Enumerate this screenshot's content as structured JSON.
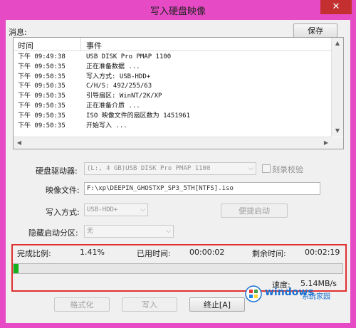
{
  "window": {
    "title": "写入硬盘映像",
    "close_glyph": "✕"
  },
  "messages": {
    "label": "消息:",
    "save_button": "保存",
    "columns": {
      "time": "时间",
      "event": "事件"
    },
    "rows": [
      {
        "time": "下午 09:49:38",
        "event": "USB      DISK Pro PMAP    1100"
      },
      {
        "time": "下午 09:50:35",
        "event": "正在准备数据 ..."
      },
      {
        "time": "下午 09:50:35",
        "event": "写入方式: USB-HDD+"
      },
      {
        "time": "下午 09:50:35",
        "event": "C/H/S: 492/255/63"
      },
      {
        "time": "下午 09:50:35",
        "event": "引导扇区: WinNT/2K/XP"
      },
      {
        "time": "下午 09:50:35",
        "event": "正在准备介质 ..."
      },
      {
        "time": "下午 09:50:35",
        "event": "ISO 映像文件的扇区数为 1451961"
      },
      {
        "time": "下午 09:50:35",
        "event": "开始写入 ..."
      }
    ]
  },
  "form": {
    "drive_label": "硬盘驱动器:",
    "drive_value": "(L:, 4 GB)USB       DISK Pro PMAP    1100",
    "verify_label": "刻录校验",
    "image_label": "映像文件:",
    "image_value": "F:\\xp\\DEEPIN_GHOSTXP_SP3_5TH[NTFS].iso",
    "mode_label": "写入方式:",
    "mode_value": "USB-HDD+",
    "boot_button": "便捷启动",
    "hidden_label": "隐藏启动分区:",
    "hidden_value": "无"
  },
  "progress": {
    "done_label": "完成比例:",
    "done_value": "1.41%",
    "elapsed_label": "已用时间:",
    "elapsed_value": "00:00:02",
    "remaining_label": "剩余时间:",
    "remaining_value": "00:02:19",
    "speed_label": "速度:",
    "speed_value": "5.14MB/s",
    "fraction": 0.0141,
    "bar_color": "#16b01c"
  },
  "buttons": {
    "format": "格式化",
    "write": "写入",
    "stop": "终止[A]"
  },
  "watermark": {
    "text": "windows",
    "sub": "系统家园"
  },
  "colors": {
    "titlebar": "#e64ac4",
    "highlight": "#e03030"
  }
}
